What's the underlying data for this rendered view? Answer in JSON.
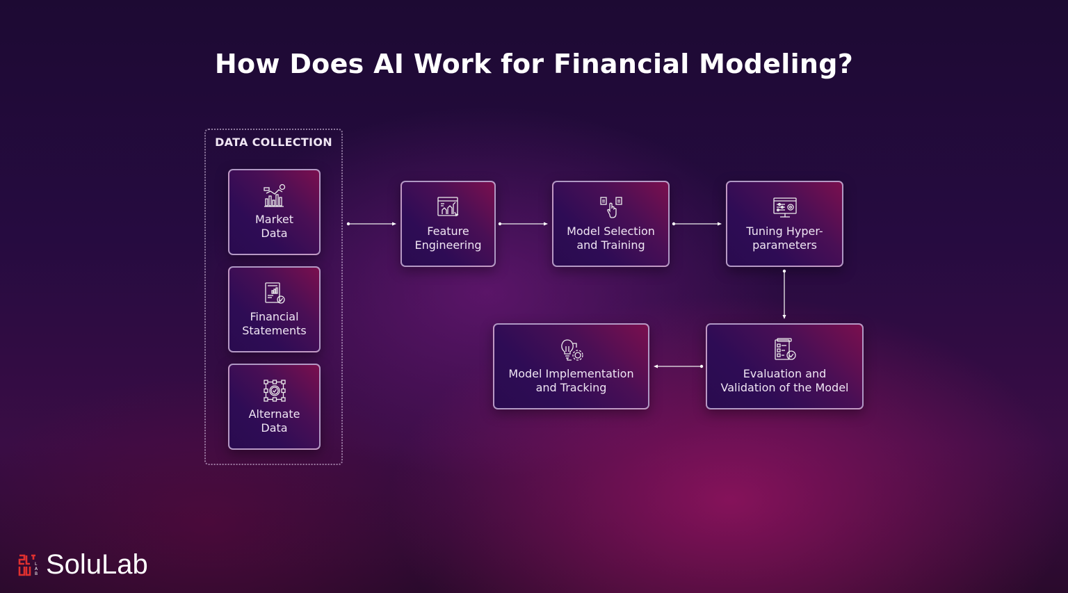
{
  "title": "How Does AI Work for Financial Modeling?",
  "data_collection": {
    "label": "DATA COLLECTION",
    "items": [
      {
        "label_line1": "Market",
        "label_line2": "Data",
        "icon": "market-chart-icon"
      },
      {
        "label_line1": "Financial",
        "label_line2": "Statements",
        "icon": "financial-report-icon"
      },
      {
        "label_line1": "Alternate",
        "label_line2": "Data",
        "icon": "data-network-icon"
      }
    ]
  },
  "steps": [
    {
      "label_line1": "Feature",
      "label_line2": "Engineering",
      "icon": "analytics-window-icon"
    },
    {
      "label_line1": "Model Selection",
      "label_line2": "and Training",
      "icon": "hand-select-icon"
    },
    {
      "label_line1": "Tuning Hyper-",
      "label_line2": "parameters",
      "icon": "monitor-settings-icon"
    },
    {
      "label_line1": "Evaluation and",
      "label_line2": "Validation of the Model",
      "icon": "checklist-icon"
    },
    {
      "label_line1": "Model Implementation",
      "label_line2": "and Tracking",
      "icon": "idea-gear-icon"
    }
  ],
  "brand": {
    "name": "SoluLab",
    "accent": "#e0302f"
  },
  "colors": {
    "card_border": "#dcc8eb",
    "text": "#f0e6f4"
  }
}
